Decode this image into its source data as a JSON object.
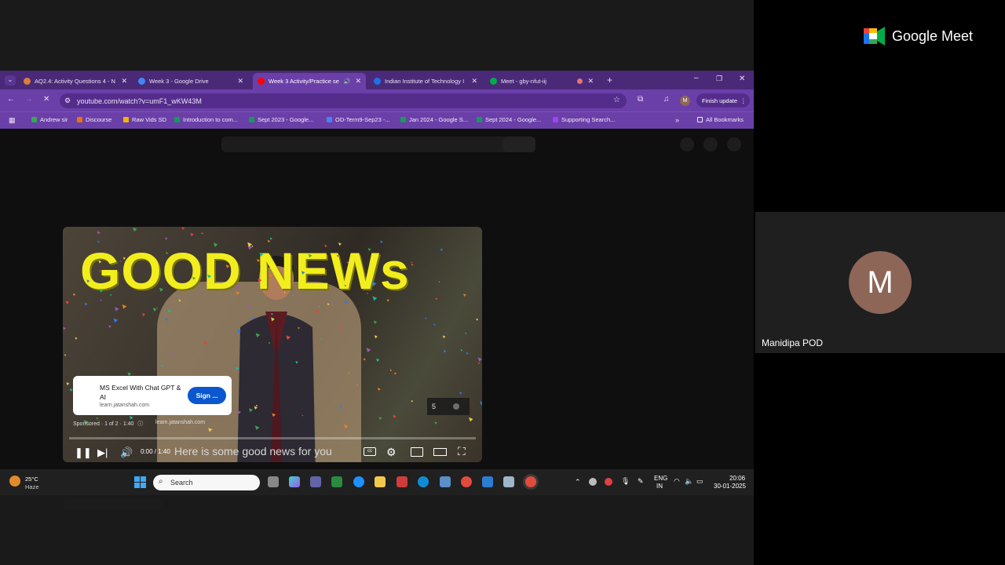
{
  "browser": {
    "tabs": [
      {
        "label": "AQ2.4: Activity Questions 4 - N",
        "color": "#e07b39"
      },
      {
        "label": "Week 3 - Google Drive",
        "color": "#4285f4"
      },
      {
        "label": "Week 3 Activity/Practice se",
        "color": "#ff0000"
      },
      {
        "label": "Indian Institute of Technology I",
        "color": "#1a73e8"
      },
      {
        "label": "Meet - gby-nfut-iij",
        "color": "#00ac47"
      }
    ],
    "new_tab": "+",
    "address": "youtube.com/watch?v=umF1_wKW43M",
    "finish_update": "Finish update",
    "profile_initial": "M",
    "bookmarks": [
      {
        "label": "Andrew sir",
        "color": "#34a853"
      },
      {
        "label": "Discourse",
        "color": "#e8710a"
      },
      {
        "label": "Raw Vids SD",
        "color": "#f4b400"
      },
      {
        "label": "Introduction to com...",
        "color": "#0f9d58"
      },
      {
        "label": "Sept 2023 - Google...",
        "color": "#0f9d58"
      },
      {
        "label": "OD-Term9-Sep23 -...",
        "color": "#4285f4"
      },
      {
        "label": "Jan 2024 - Google S...",
        "color": "#0f9d58"
      },
      {
        "label": "Sept 2024 - Google...",
        "color": "#0f9d58"
      },
      {
        "label": "Supporting Search...",
        "color": "#a142f4"
      }
    ],
    "all_bookmarks": "All Bookmarks"
  },
  "video": {
    "headline": "GOOD NEWs",
    "ad_title": "MS Excel With Chat GPT & AI",
    "ad_domain": "learn.jatanshah.com",
    "ad_button": "Sign ...",
    "sponsored": "Sponsored · 1 of 2 · 1:40",
    "sponsored_domain": "learn.jatanshah.com",
    "skip_count": "5",
    "time": "0:00 / 1:40",
    "caption": "Here is some good news for you",
    "progress_fraction": 0.0
  },
  "taskbar": {
    "weather_temp": "25°C",
    "weather_desc": "Haze",
    "search_placeholder": "Search",
    "lang_top": "ENG",
    "lang_bottom": "IN",
    "time": "20:06",
    "date": "30-01-2025"
  },
  "meet": {
    "brand": "Google Meet",
    "participant_initial": "M",
    "participant_name": "Manidipa POD"
  }
}
